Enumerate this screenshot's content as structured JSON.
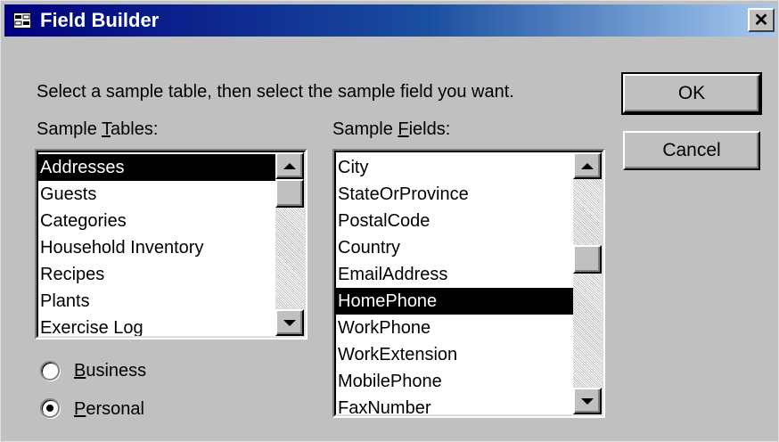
{
  "window": {
    "title": "Field Builder",
    "icon": "field-builder-icon",
    "close_glyph": "✕"
  },
  "instruction": "Select a sample table, then select the sample field you want.",
  "buttons": {
    "ok": "OK",
    "cancel": "Cancel"
  },
  "sample_tables": {
    "label_prefix": "Sample ",
    "label_mnemonic": "T",
    "label_suffix": "ables:",
    "items": [
      "Addresses",
      "Guests",
      "Categories",
      "Household Inventory",
      "Recipes",
      "Plants",
      "Exercise Log"
    ],
    "selected": "Addresses"
  },
  "sample_fields": {
    "label_prefix": "Sample ",
    "label_mnemonic": "F",
    "label_suffix": "ields:",
    "items": [
      "City",
      "StateOrProvince",
      "PostalCode",
      "Country",
      "EmailAddress",
      "HomePhone",
      "WorkPhone",
      "WorkExtension",
      "MobilePhone",
      "FaxNumber"
    ],
    "selected": "HomePhone"
  },
  "category": {
    "business_mnemonic": "B",
    "business_rest": "usiness",
    "personal_mnemonic": "P",
    "personal_rest": "ersonal",
    "selected": "Personal"
  }
}
